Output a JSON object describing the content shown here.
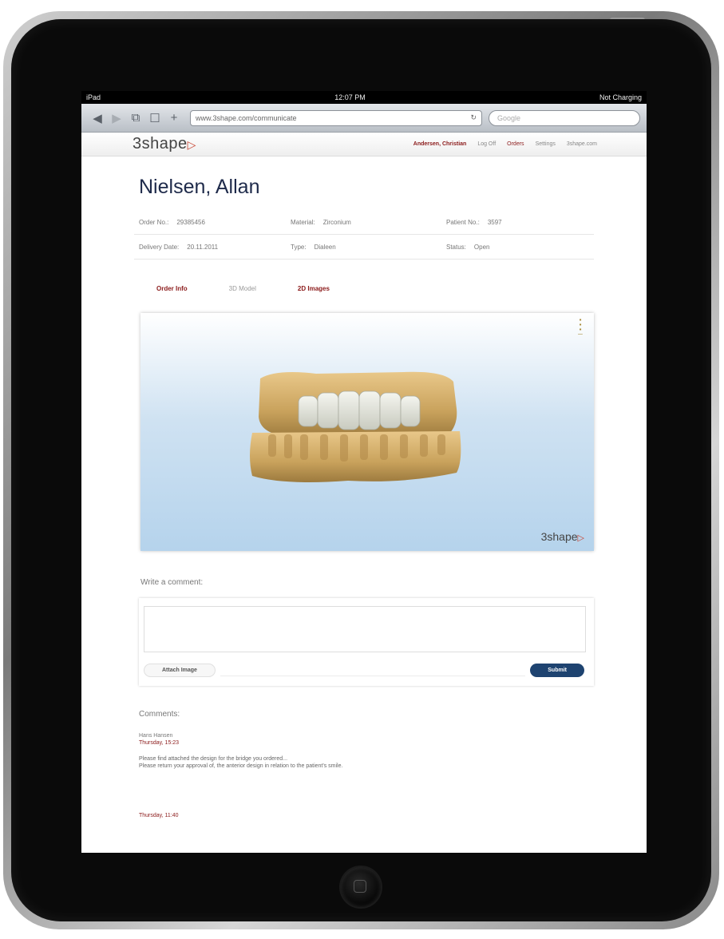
{
  "status_bar": {
    "device": "iPad",
    "time": "12:07 PM",
    "battery": "Not Charging"
  },
  "browser": {
    "url": "www.3shape.com/communicate",
    "search_placeholder": "Google"
  },
  "site": {
    "logo": "3shape",
    "nav": {
      "user": "Andersen, Christian",
      "logoff": "Log Off",
      "orders": "Orders",
      "settings": "Settings",
      "site": "3shape.com"
    }
  },
  "patient": {
    "name": "Nielsen, Allan"
  },
  "order_info": {
    "row1": [
      {
        "label": "Order No.:",
        "value": "29385456"
      },
      {
        "label": "Material:",
        "value": "Zirconium"
      },
      {
        "label": "Patient No.:",
        "value": "3597"
      }
    ],
    "row2": [
      {
        "label": "Delivery Date:",
        "value": "20.11.2011"
      },
      {
        "label": "Type:",
        "value": "Dialeen"
      },
      {
        "label": "Status:",
        "value": "Open"
      }
    ]
  },
  "tabs": {
    "order_info": "Order Info",
    "model_3d": "3D Model",
    "images_2d": "2D Images"
  },
  "viewer": {
    "logo": "3shape"
  },
  "comment_form": {
    "label": "Write a comment:",
    "attach": "Attach Image",
    "submit": "Submit"
  },
  "comments": {
    "label": "Comments:",
    "items": [
      {
        "author": "Hans Hansen",
        "time": "Thursday, 15:23",
        "text1": "Please find attached the design for the bridge you ordered...",
        "text2": "Please return your approval of, the anterior design in relation to the patient's smile."
      },
      {
        "time": "Thursday, 11:40"
      }
    ]
  },
  "colors": {
    "accent_red": "#8b1a1a",
    "submit_blue": "#1e4370",
    "title_navy": "#1e2a4a"
  }
}
